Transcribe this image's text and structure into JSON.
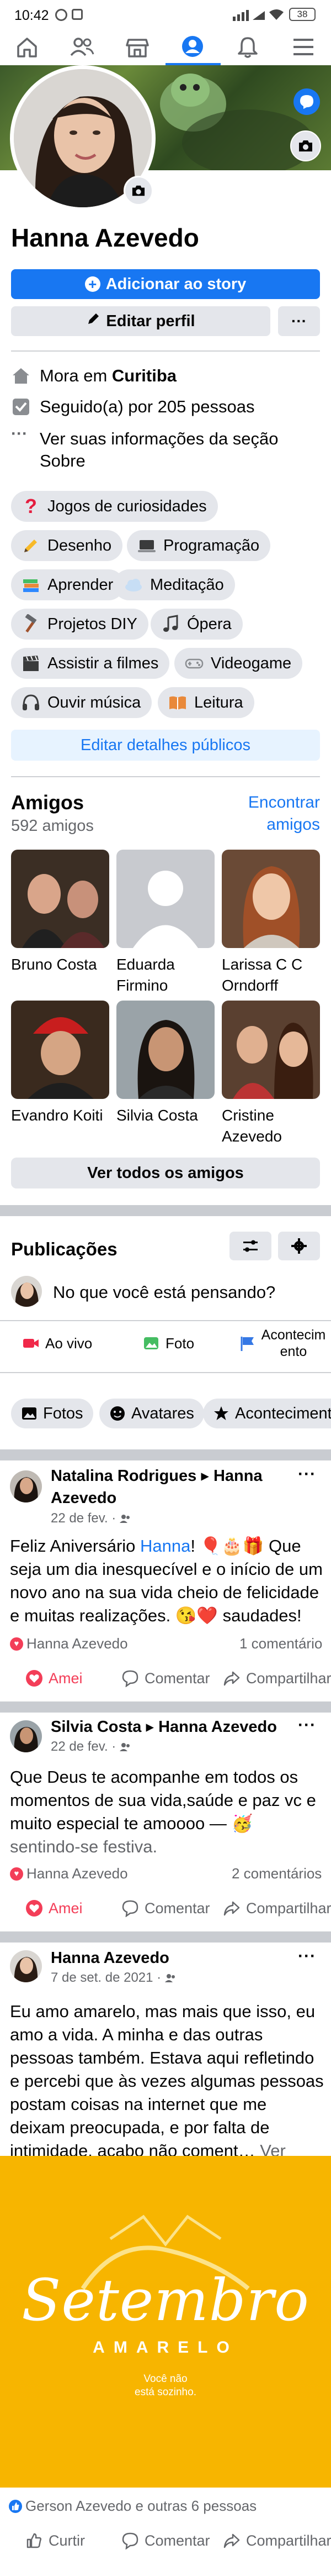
{
  "status_bar": {
    "time": "10:42",
    "battery": "38"
  },
  "profile": {
    "name": "Hanna Azevedo",
    "add_story": "Adicionar ao story",
    "edit_profile": "Editar perfil",
    "more": "···",
    "lives_prefix": "Mora em ",
    "lives_city": "Curitiba",
    "followers": "Seguido(a) por 205 pessoas",
    "about_more": "Ver suas informações da seção Sobre",
    "edit_details": "Editar detalhes públicos"
  },
  "interests": [
    {
      "label": "Jogos de curiosidades",
      "icon": "question-icon",
      "color": "#e41e3f"
    },
    {
      "label": "Desenho",
      "icon": "pencil-icon",
      "color": "#f7b928"
    },
    {
      "label": "Programação",
      "icon": "laptop-icon",
      "color": "#3a3b3c"
    },
    {
      "label": "Aprender",
      "icon": "books-icon",
      "color": "#2d88ff"
    },
    {
      "label": "Meditação",
      "icon": "cloud-icon",
      "color": "#c7def5"
    },
    {
      "label": "Projetos DIY",
      "icon": "hammer-icon",
      "color": "#a0522d"
    },
    {
      "label": "Ópera",
      "icon": "music-note-icon",
      "color": "#3a3b3c"
    },
    {
      "label": "Assistir a filmes",
      "icon": "clapper-icon",
      "color": "#3a3b3c"
    },
    {
      "label": "Videogame",
      "icon": "gamepad-icon",
      "color": "#8a8d91"
    },
    {
      "label": "Ouvir música",
      "icon": "headphones-icon",
      "color": "#3a3b3c"
    },
    {
      "label": "Leitura",
      "icon": "book-icon",
      "color": "#e9893a"
    }
  ],
  "friends": {
    "title": "Amigos",
    "count": "592 amigos",
    "find": "Encontrar amigos",
    "see_all": "Ver todos os amigos",
    "list": [
      {
        "name": "Bruno Costa",
        "color": "#4a3a2a"
      },
      {
        "name": "Eduarda Firmino",
        "color": "#c8cacf"
      },
      {
        "name": "Larissa C C Orndorff",
        "color": "#8a5a3c"
      },
      {
        "name": "Evandro Koiti",
        "color": "#8b2b2b"
      },
      {
        "name": "Silvia Costa",
        "color": "#5a4d40"
      },
      {
        "name": "Cristine Azevedo",
        "color": "#6b4a3a"
      }
    ]
  },
  "publications": {
    "title": "Publicações",
    "composer_placeholder": "No que você está pensando?",
    "live": "Ao vivo",
    "photo": "Foto",
    "event": "Acontecimento",
    "tabs": [
      "Fotos",
      "Avatares",
      "Acontecimentos"
    ]
  },
  "posts": [
    {
      "author": "Natalina Rodrigues",
      "target": "Hanna Azevedo",
      "date": "22 de fev. ·",
      "text_before": "Feliz Aniversário ",
      "text_mention": "Hanna",
      "text_after": "! 🎈🎂🎁 Que seja um dia inesquecível e o início de um novo ano na sua vida cheio de felicidade e muitas realizações. 😘❤️ saudades!",
      "reactor": "Hanna Azevedo",
      "comments": "1 comentário",
      "like": "Amei",
      "comment": "Comentar",
      "share": "Compartilhar"
    },
    {
      "author": "Silvia Costa",
      "target": "Hanna Azevedo",
      "date": "22 de fev. ·",
      "text": "Que Deus te acompanhe em todos os momentos de sua vida,saúde e paz vc e muito especial te amoooo — 🥳",
      "feeling": "sentindo-se festiva.",
      "reactor": "Hanna Azevedo",
      "comments": "2 comentários",
      "like": "Amei",
      "comment": "Comentar",
      "share": "Compartilhar"
    },
    {
      "author": "Hanna Azevedo",
      "date": "7 de set. de 2021 ·",
      "text": "Eu amo amarelo, mas mais que isso, eu amo a vida. A minha e das outras pessoas também. Estava aqui refletindo e percebi que às vezes algumas pessoas postam coisas na internet que me deixam preocupada, e por falta de intimidade, acabo não coment…",
      "more": "Ver mais",
      "image_title": "Setembro",
      "image_subtitle": "AMARELO",
      "image_caption_1": "Você não",
      "image_caption_2": "está sozinho.",
      "reactors": "Gerson Azevedo e outras 6 pessoas",
      "like": "Curtir",
      "comment": "Comentar",
      "share": "Compartilhar"
    }
  ],
  "colors": {
    "accent": "#1877f2",
    "love": "#f33e58",
    "yellow": "#f7b500"
  }
}
